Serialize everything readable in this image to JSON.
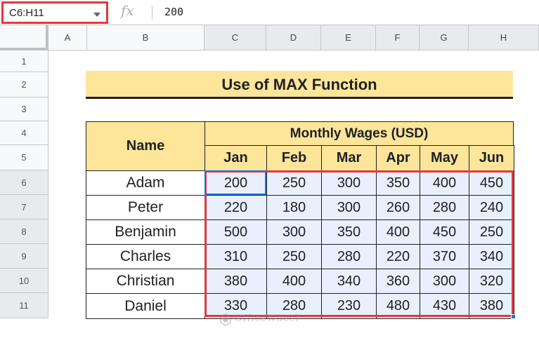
{
  "name_box": {
    "value": "C6:H11"
  },
  "formula_bar": {
    "fx_label": "fx",
    "value": "200"
  },
  "columns": [
    "A",
    "B",
    "C",
    "D",
    "E",
    "F",
    "G",
    "H"
  ],
  "rows": [
    "1",
    "2",
    "3",
    "4",
    "5",
    "6",
    "7",
    "8",
    "9",
    "10",
    "11"
  ],
  "title": "Use of MAX Function",
  "table": {
    "name_header": "Name",
    "group_header": "Monthly Wages (USD)",
    "months": [
      "Jan",
      "Feb",
      "Mar",
      "Apr",
      "May",
      "Jun"
    ],
    "rows": [
      {
        "name": "Adam",
        "values": [
          "200",
          "250",
          "300",
          "350",
          "400",
          "450"
        ]
      },
      {
        "name": "Peter",
        "values": [
          "220",
          "180",
          "300",
          "260",
          "280",
          "240"
        ]
      },
      {
        "name": "Benjamin",
        "values": [
          "500",
          "300",
          "350",
          "400",
          "450",
          "250"
        ]
      },
      {
        "name": "Charles",
        "values": [
          "310",
          "250",
          "280",
          "220",
          "370",
          "340"
        ]
      },
      {
        "name": "Christian",
        "values": [
          "380",
          "400",
          "340",
          "360",
          "300",
          "320"
        ]
      },
      {
        "name": "Daniel",
        "values": [
          "330",
          "280",
          "230",
          "480",
          "430",
          "380"
        ]
      }
    ]
  },
  "watermark": "OfficeWheel",
  "colors": {
    "header_fill": "#fde59a",
    "selection_fill": "#e8f0fe",
    "selection_outline": "#e0393e",
    "active_cell": "#1a73e8"
  }
}
